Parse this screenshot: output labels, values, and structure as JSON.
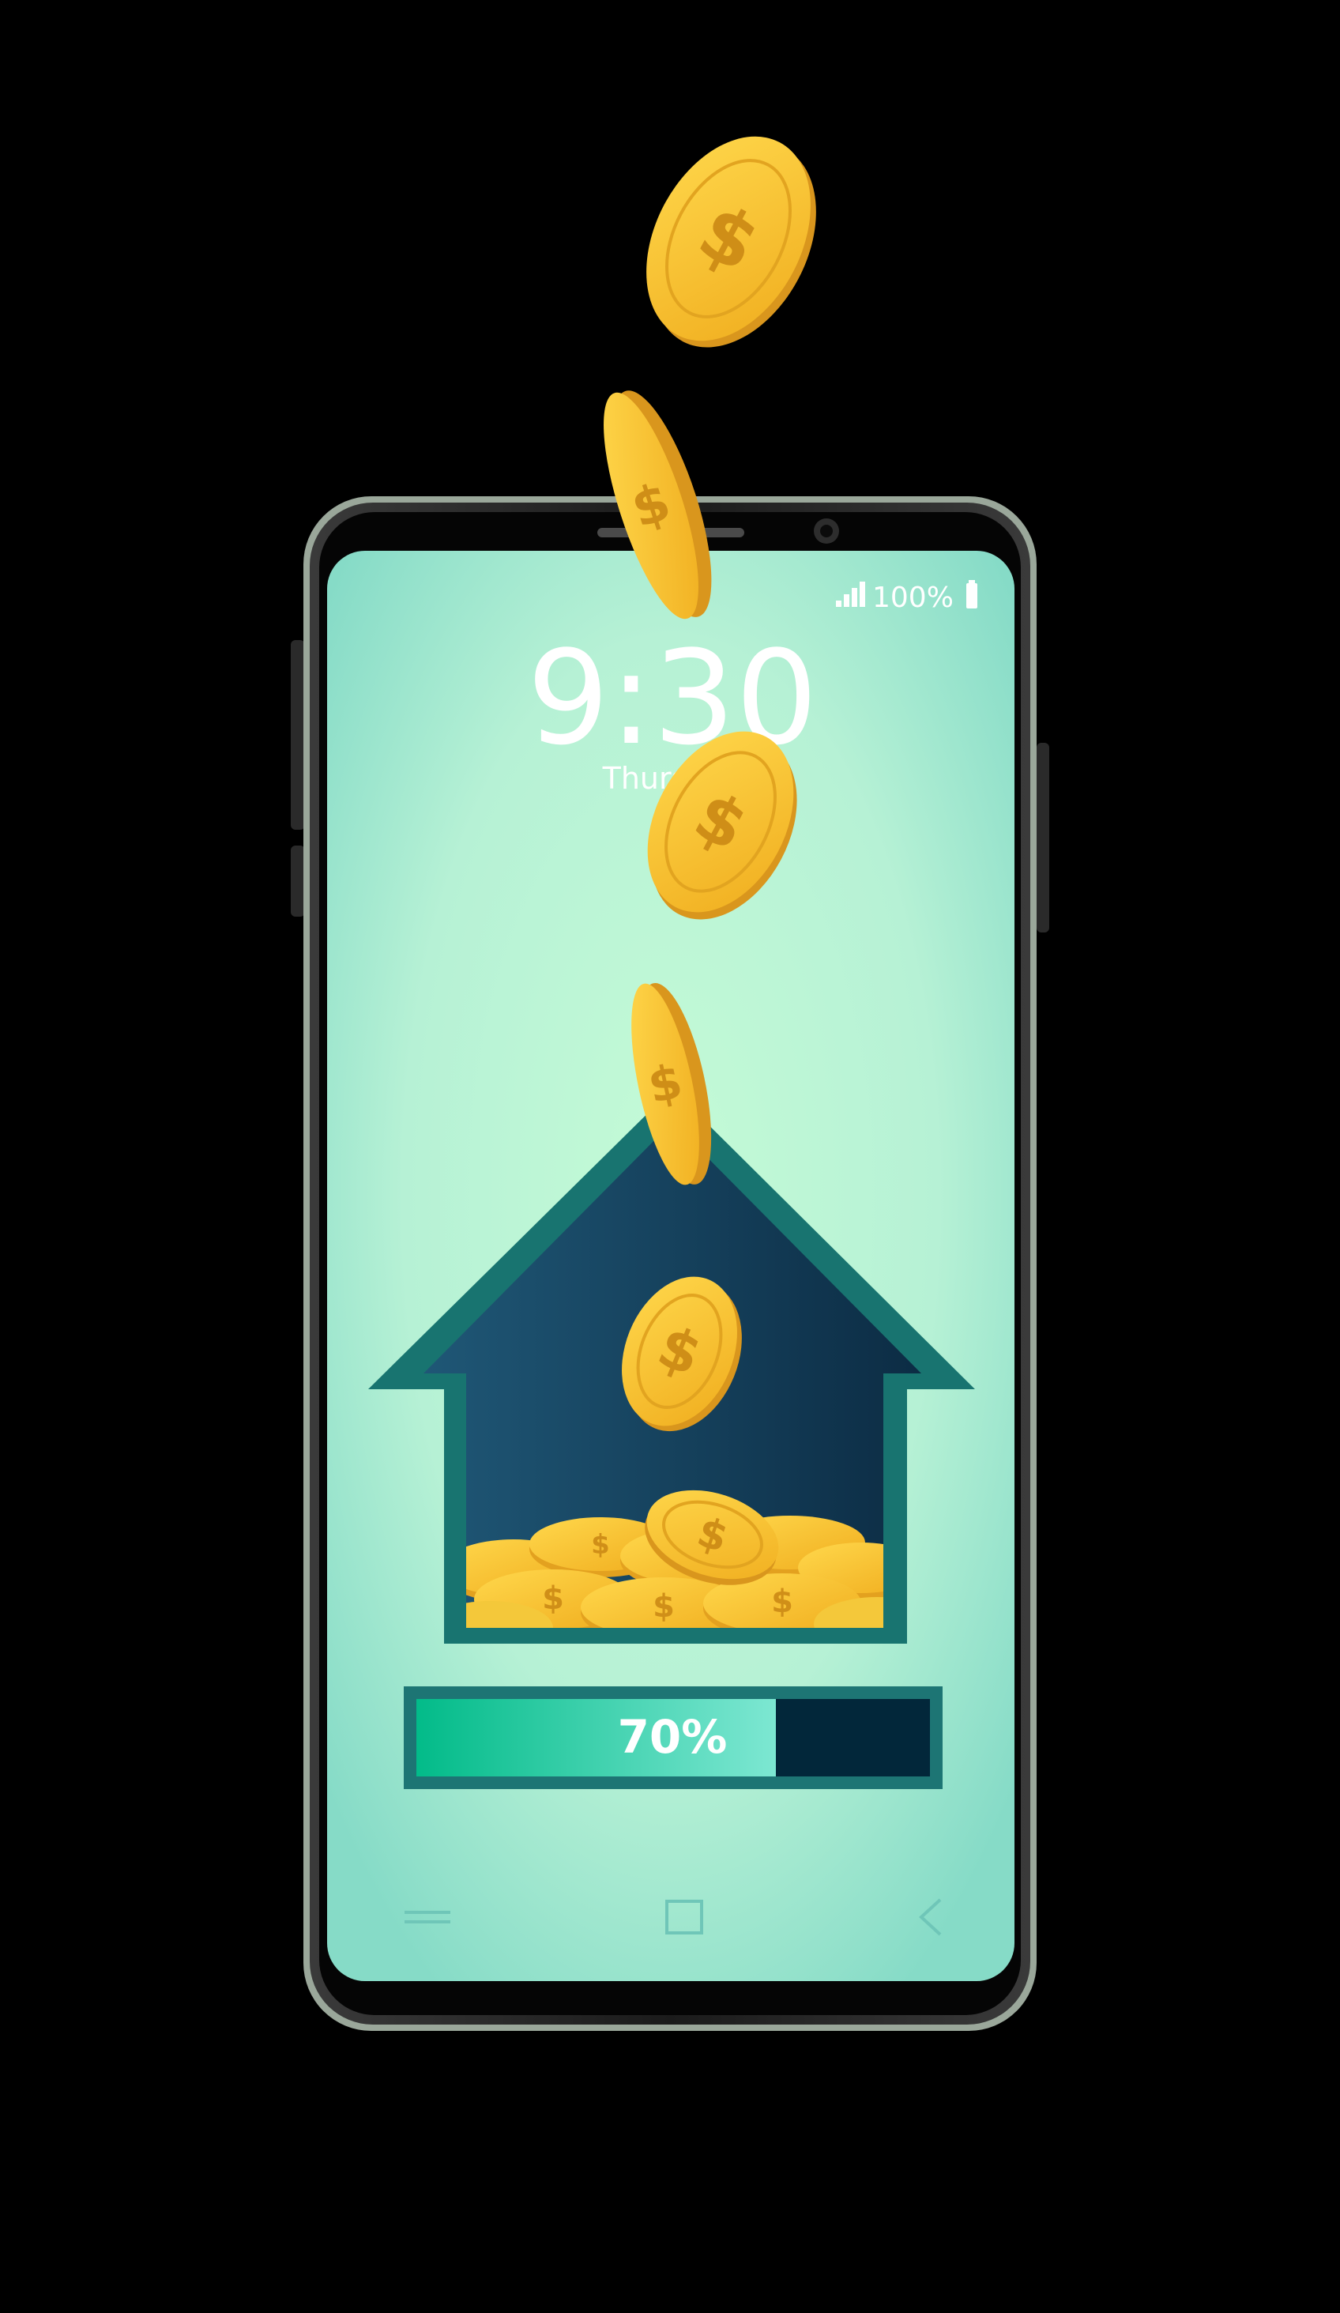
{
  "status_bar": {
    "battery": "100%"
  },
  "lockscreen": {
    "time": "9:30",
    "day": "Thursday"
  },
  "savings": {
    "progress_label": "70%",
    "progress": 0.7
  },
  "colors": {
    "screen_bg": "#c4fbd7",
    "screen_edge": "#89dcc6",
    "house_fill": "#173f5c",
    "house_border": "#187470",
    "coin": "#f6bf27",
    "coin_dark": "#d9961d",
    "progress_fill": "#0fc89a",
    "progress_track": "#02273a"
  },
  "icons": {
    "signal": "signal-icon",
    "battery": "battery-icon",
    "menu": "menu-icon",
    "home": "home-icon",
    "back": "back-icon",
    "coin": "dollar-coin-icon",
    "house": "house-icon"
  }
}
